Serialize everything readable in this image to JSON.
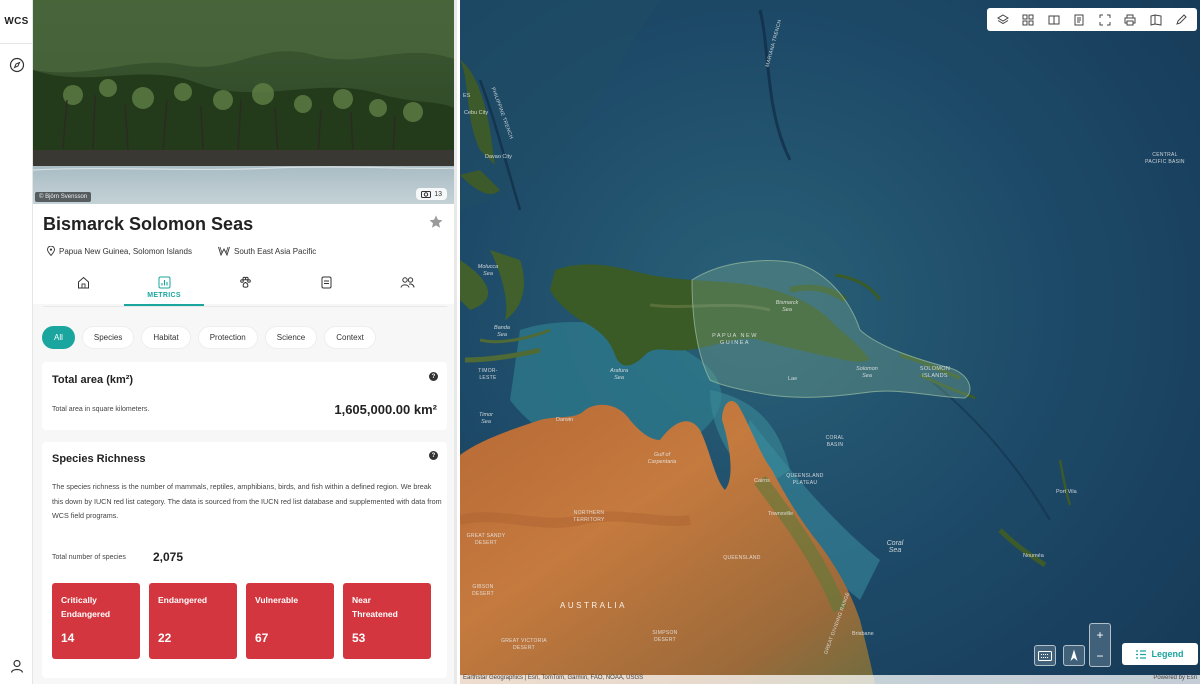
{
  "app": {
    "logo": "WCS"
  },
  "rail": {
    "nav_icon": "compass-icon",
    "user_icon": "user-icon"
  },
  "hero": {
    "credit": "© Björn Svensson",
    "photo_count": "13"
  },
  "site": {
    "title": "Bismarck Solomon Seas",
    "location": "Papua New Guinea, Solomon Islands",
    "region": "South East Asia Pacific"
  },
  "tabs": [
    {
      "icon": "home-icon",
      "label": ""
    },
    {
      "icon": "chart-icon",
      "label": "METRICS"
    },
    {
      "icon": "paw-icon",
      "label": ""
    },
    {
      "icon": "document-icon",
      "label": ""
    },
    {
      "icon": "people-icon",
      "label": ""
    }
  ],
  "filters": [
    "All",
    "Species",
    "Habitat",
    "Protection",
    "Science",
    "Context"
  ],
  "total_area": {
    "title": "Total area (km²)",
    "description": "Total area in square kilometers.",
    "value": "1,605,000.00 km²"
  },
  "species_richness": {
    "title": "Species Richness",
    "description": "The species richness is the number of mammals, reptiles, amphibians, birds, and fish within a defined region. We break this down by IUCN red list category. The data is sourced from the IUCN red list database and supplemented with data from WCS field programs.",
    "total_label": "Total number of species",
    "total_value": "2,075",
    "categories": [
      {
        "name_line1": "Critically",
        "name_line2": "Endangered",
        "count": "14"
      },
      {
        "name_line1": "Endangered",
        "name_line2": "",
        "count": "22"
      },
      {
        "name_line1": "Vulnerable",
        "name_line2": "",
        "count": "67"
      },
      {
        "name_line1": "Near",
        "name_line2": "Threatened",
        "count": "53"
      }
    ]
  },
  "map": {
    "labels": {
      "mariana": "MARIANA TRENCH",
      "philippine": "PHILIPPINE TRENCH",
      "cebu": "Cebu City",
      "davao": "Davao City",
      "es": "ES",
      "central_pacific": "CENTRAL PACIFIC BASIN",
      "molucca": "Molucca Sea",
      "banda": "Banda Sea",
      "timor_leste": "TIMOR-LESTE",
      "timor_sea": "Timor Sea",
      "arafura": "Arafura Sea",
      "bismarck": "Bismarck Sea",
      "png": "PAPUA NEW GUINEA",
      "solomon_sea": "Solomon Sea",
      "solomon_is": "SOLOMON ISLANDS",
      "darwin": "Darwin",
      "gulf": "Gulf of Carpentaria",
      "coral_basin": "CORAL BASIN",
      "qld_plateau": "QUEENSLAND PLATEAU",
      "cairns": "Cairns",
      "townsville": "Townsville",
      "port_vila": "Port Vila",
      "coral_sea": "Coral Sea",
      "noumea": "Nouméa",
      "nt": "NORTHERN TERRITORY",
      "great_sandy": "GREAT SANDY DESERT",
      "queensland": "QUEENSLAND",
      "gibson": "GIBSON DESERT",
      "australia": "AUSTRALIA",
      "range": "GREAT DIVIDING RANGE",
      "great_victoria": "GREAT VICTORIA DESERT",
      "simpson": "SIMPSON DESERT",
      "brisbane": "Brisbane",
      "lae": "Lae"
    },
    "tool_icons": [
      "layers-icon",
      "grid-icon",
      "compare-icon",
      "report-icon",
      "fullscreen-icon",
      "print-icon",
      "bookmark-icon",
      "draw-icon"
    ],
    "legend_label": "Legend",
    "attribution": "Earthstar Geographics | Esri, TomTom, Garmin, FAO, NOAA, USGS",
    "powered_by": "Powered by Esri"
  },
  "colors": {
    "accent": "#1aa59e",
    "risk": "#d4363f"
  }
}
